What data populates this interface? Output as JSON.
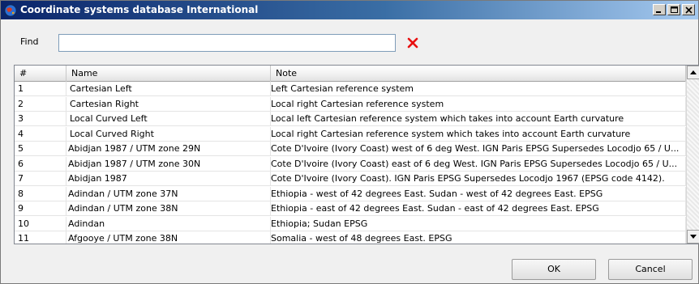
{
  "window": {
    "title": "Coordinate systems database International"
  },
  "find": {
    "label": "Find",
    "value": "",
    "placeholder": ""
  },
  "table": {
    "columns": [
      "#",
      "Name",
      "Note"
    ],
    "rows": [
      {
        "num": "1",
        "name": "Cartesian Left",
        "note": "Left Cartesian reference system"
      },
      {
        "num": "2",
        "name": "Cartesian Right",
        "note": "Local right Cartesian reference system"
      },
      {
        "num": "3",
        "name": "Local Curved Left",
        "note": "Local left Cartesian reference system which takes into account Earth curvature"
      },
      {
        "num": "4",
        "name": "Local Curved Right",
        "note": "Local right Cartesian reference system which takes into account Earth curvature"
      },
      {
        "num": "5",
        "name": "Abidjan 1987 / UTM zone 29N",
        "note": "Cote D'Ivoire (Ivory Coast) west of 6 deg West. IGN Paris EPSG Supersedes Locodjo 65 / U..."
      },
      {
        "num": "6",
        "name": "Abidjan 1987 / UTM zone 30N",
        "note": "Cote D'Ivoire (Ivory Coast) east of 6 deg West. IGN Paris EPSG Supersedes Locodjo 65 / U..."
      },
      {
        "num": "7",
        "name": "Abidjan 1987",
        "note": "Cote D'Ivoire (Ivory Coast). IGN Paris EPSG Supersedes Locodjo 1967 (EPSG code 4142)."
      },
      {
        "num": "8",
        "name": "Adindan / UTM zone 37N",
        "note": "Ethiopia - west of 42 degrees East.  Sudan - west of 42 degrees East. EPSG"
      },
      {
        "num": "9",
        "name": "Adindan / UTM zone 38N",
        "note": "Ethiopia - east of 42 degrees East.  Sudan - east of 42 degrees East. EPSG"
      },
      {
        "num": "10",
        "name": "Adindan",
        "note": "Ethiopia; Sudan EPSG"
      },
      {
        "num": "11",
        "name": "Afgooye / UTM zone 38N",
        "note": "Somalia - west of 48 degrees East. EPSG"
      }
    ]
  },
  "buttons": {
    "ok": "OK",
    "cancel": "Cancel"
  },
  "icons": {
    "app": "globe-icon",
    "clear": "red-x-icon",
    "minimize": "minimize-icon",
    "maximize": "maximize-icon",
    "close": "close-icon"
  },
  "colors": {
    "clear_x": "#e81010",
    "title_start": "#0a246a",
    "title_end": "#a6caf0"
  }
}
